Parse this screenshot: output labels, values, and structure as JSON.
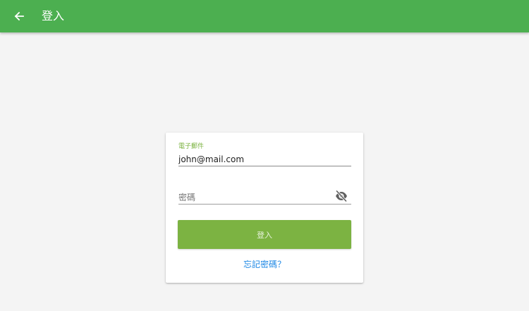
{
  "appbar": {
    "title": "登入",
    "back_icon": "arrow-left-icon",
    "color": "#4caf50"
  },
  "form": {
    "email": {
      "label": "電子郵件",
      "value": "john@mail.com"
    },
    "password": {
      "placeholder": "密碼",
      "value": "",
      "toggle_icon": "eye-off-icon"
    },
    "submit_label": "登入",
    "forgot_label": "忘記密碼？",
    "accent": "#7cb342",
    "link_color": "#1e88e5"
  }
}
